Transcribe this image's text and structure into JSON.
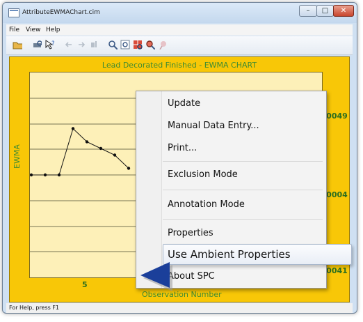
{
  "window": {
    "title": "AttributeEWMAChart.cim",
    "controls": {
      "minimize": "–",
      "maximize": "□",
      "close": "✕"
    }
  },
  "menubar": {
    "items": [
      "File",
      "View",
      "Help"
    ]
  },
  "toolbar": {
    "icons": [
      "open-icon",
      "print-preview-icon",
      "help-pointer-icon",
      "back-arrow-icon",
      "forward-arrow-icon",
      "bar-icon",
      "zoom-icon",
      "zoom-window-icon",
      "zoom-grid-icon",
      "zoom-out-icon",
      "pin-icon"
    ]
  },
  "chart": {
    "title": "Lead Decorated Finished - EWMA CHART",
    "y_axis_label": "EWMA",
    "x_axis_label": "Observation Number",
    "y_tick_labels": [
      ".0049",
      ".0004",
      ".0041"
    ],
    "x_tick_label": "5"
  },
  "chart_data": {
    "type": "line",
    "title": "Lead Decorated Finished - EWMA CHART",
    "xlabel": "Observation Number",
    "ylabel": "EWMA",
    "visible_points": [
      {
        "x": 1,
        "y": 0.0004
      },
      {
        "x": 2,
        "y": 0.0004
      },
      {
        "x": 3,
        "y": 0.0004
      },
      {
        "x": 4,
        "y": 0.0011
      },
      {
        "x": 5,
        "y": 0.0009
      },
      {
        "x": 6,
        "y": 0.0008
      },
      {
        "x": 7,
        "y": 0.0007
      },
      {
        "x": 8,
        "y": 0.0005
      }
    ],
    "y_ticks": [
      0.0049,
      0.0004,
      0.0041
    ],
    "grid": true
  },
  "context_menu": {
    "items": [
      {
        "label": "Update",
        "group": 1
      },
      {
        "label": "Manual Data Entry...",
        "group": 1
      },
      {
        "label": "Print...",
        "group": 1
      },
      {
        "label": "Exclusion Mode",
        "group": 2
      },
      {
        "label": "Annotation Mode",
        "group": 3
      },
      {
        "label": "Properties",
        "group": 4
      },
      {
        "label": "Use Ambient Properties",
        "group": 4,
        "highlighted": true
      },
      {
        "label": "About SPC",
        "group": 5
      }
    ]
  },
  "status": {
    "text": "For Help, press F1"
  },
  "colors": {
    "chart_background": "#f8c707",
    "plot_background": "#fdf0b8",
    "chart_text": "#3e8b32",
    "pointer_arrow": "#1b3f9a"
  }
}
